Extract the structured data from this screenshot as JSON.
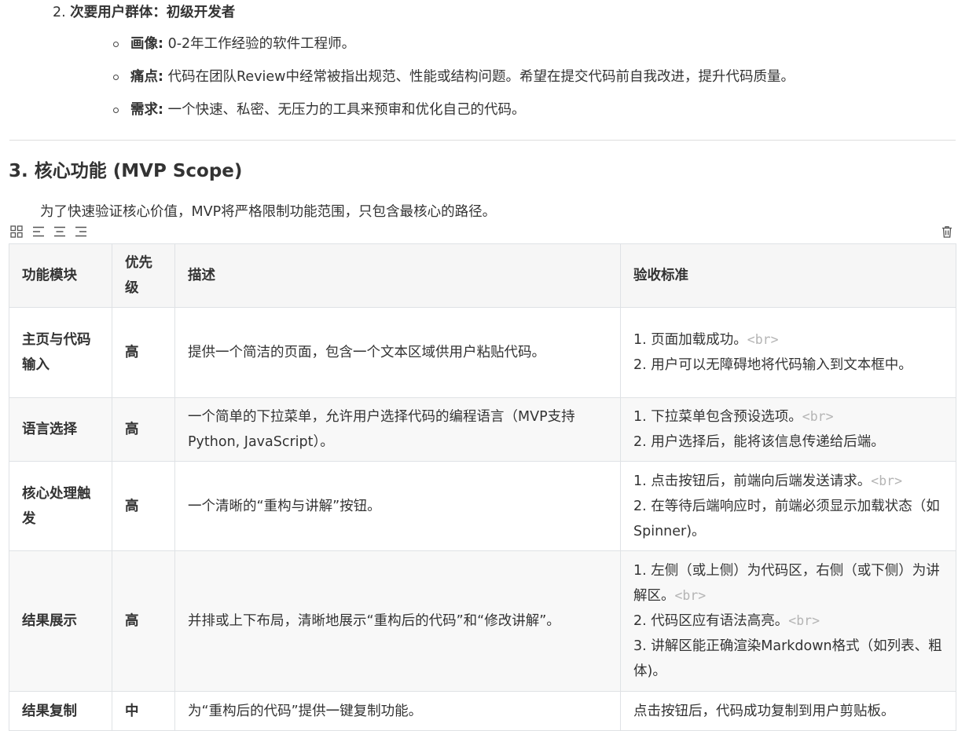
{
  "persona": {
    "number": "2.",
    "title": "次要用户群体：初级开发者",
    "bullets": [
      {
        "label": "画像:",
        "text": " 0-2年工作经验的软件工程师。"
      },
      {
        "label": "痛点:",
        "text": " 代码在团队Review中经常被指出规范、性能或结构问题。希望在提交代码前自我改进，提升代码质量。"
      },
      {
        "label": "需求:",
        "text": " 一个快速、私密、无压力的工具来预审和优化自己的代码。"
      }
    ]
  },
  "section": {
    "heading": "3. 核心功能 (MVP Scope)",
    "intro": "为了快速验证核心价值，MVP将严格限制功能范围，只包含最核心的路径。"
  },
  "toolbar": {
    "icons": [
      "table-grid-icon",
      "align-left-icon",
      "align-center-icon",
      "align-right-icon",
      "trash-icon"
    ]
  },
  "table": {
    "headers": [
      "功能模块",
      "优先级",
      "描述",
      "验收标准"
    ],
    "br_tag": "<br>",
    "rows": [
      {
        "module": "主页与代码输入",
        "priority": "高",
        "description": "提供一个简洁的页面，包含一个文本区域供用户粘贴代码。",
        "criteria": [
          "1. 页面加载成功。",
          "2. 用户可以无障碍地将代码输入到文本框中。"
        ]
      },
      {
        "module": "语言选择",
        "priority": "高",
        "description": "一个简单的下拉菜单，允许用户选择代码的编程语言（MVP支持Python, JavaScript）。",
        "criteria": [
          "1. 下拉菜单包含预设选项。",
          "2. 用户选择后，能将该信息传递给后端。"
        ]
      },
      {
        "module": "核心处理触发",
        "priority": "高",
        "description": "一个清晰的“重构与讲解”按钮。",
        "criteria": [
          "1. 点击按钮后，前端向后端发送请求。",
          "2. 在等待后端响应时，前端必须显示加载状态（如Spinner)。"
        ]
      },
      {
        "module": "结果展示",
        "priority": "高",
        "description": "并排或上下布局，清晰地展示“重构后的代码”和“修改讲解”。",
        "criteria": [
          "1. 左侧（或上侧）为代码区，右侧（或下侧）为讲解区。",
          "2. 代码区应有语法高亮。",
          "3. 讲解区能正确渲染Markdown格式（如列表、粗体)。"
        ]
      },
      {
        "module": "结果复制",
        "priority": "中",
        "description": "为“重构后的代码”提供一键复制功能。",
        "criteria": [
          "点击按钮后，代码成功复制到用户剪贴板。"
        ]
      }
    ]
  }
}
